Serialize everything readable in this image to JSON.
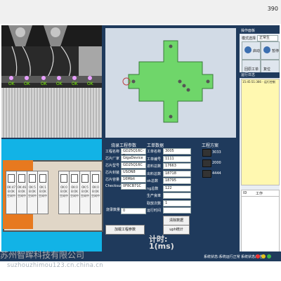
{
  "window": {
    "title_fragment": "390"
  },
  "camera": {
    "ok_marks": [
      "OK",
      "OK",
      "OK",
      "OK",
      "OK",
      "OK"
    ]
  },
  "tray": {
    "slots": [
      {
        "status": "OK:47",
        "lines": [
          "B:OK",
          "空闲中"
        ]
      },
      {
        "status": "OK:46",
        "lines": [
          "B:OK",
          "空闲中"
        ]
      },
      {
        "status": "OK:5",
        "lines": [
          "B:OK",
          "空闲中"
        ]
      },
      {
        "status": "OK:1",
        "lines": [
          "B:OK",
          "空闲中"
        ]
      },
      {
        "status": "OK:0",
        "lines": [
          "B:OK",
          "空闲中"
        ]
      },
      {
        "status": "OK:0",
        "lines": [
          "B:OK",
          "空闲中"
        ]
      },
      {
        "status": "OK:5",
        "lines": [
          "B:OK",
          "空闲中"
        ]
      },
      {
        "status": "OK:0",
        "lines": [
          "B:OK",
          "空闲中"
        ]
      }
    ]
  },
  "process_params": {
    "title": "烧录工程参数",
    "fields": [
      {
        "label": "工程名称",
        "value": "GD25Q16C-E"
      },
      {
        "label": "芯片厂家",
        "value": "GigaDevice"
      },
      {
        "label": "芯片型号",
        "value": "GD25Q16C"
      },
      {
        "label": "芯片封装",
        "value": "USON8"
      },
      {
        "label": "芯片容量",
        "value": "16Mbit"
      },
      {
        "label": "Checksum",
        "value": "0F8CB71C"
      }
    ],
    "extra_label": "烧录数量",
    "extra_value": "0",
    "load_button": "加载工程参数"
  },
  "work_data": {
    "title": "工单数据",
    "fields": [
      {
        "label": "工单名称",
        "value": "3005"
      },
      {
        "label": "工单编号",
        "value": "1111"
      },
      {
        "label": "进料总数",
        "value": "17663"
      },
      {
        "label": "出料总数",
        "value": "18718"
      },
      {
        "label": "ok总数",
        "value": "18795"
      },
      {
        "label": "ng总数",
        "value": "122"
      },
      {
        "label": "生产良率",
        "value": ""
      },
      {
        "label": "取放次数",
        "value": "1"
      },
      {
        "label": "运行时间",
        "value": ""
      }
    ],
    "clear_button": "清除数据",
    "uph_button": "uph统计",
    "timer_label": "计时:",
    "timer_value": "1(ms)"
  },
  "project": {
    "title": "工程方案",
    "items": [
      {
        "name": "3033"
      },
      {
        "name": "2000"
      },
      {
        "name": "4444"
      }
    ]
  },
  "operation": {
    "title": "操作面板",
    "mode_label": "模式选择",
    "mode_value": "正常生",
    "start_button": "启动",
    "stop_button": "暂停",
    "home_button": "回原工单",
    "reset_button": "复位"
  },
  "log": {
    "title": "运行日志",
    "entries": [
      {
        "text": "15:45:51:366 - 运行控制"
      }
    ]
  },
  "table": {
    "headers": [
      "ID",
      "工作"
    ]
  },
  "statusbar": {
    "left": "系统状态:系统运行正常",
    "right": "系统状态/警告"
  },
  "watermark": {
    "line1": "苏州智晖科技有限公司",
    "line2": "suzhouzhimou123.cn.china.cn"
  },
  "colors": {
    "frame": "#1f3a5c",
    "tray_bg": "#12b3e6",
    "accent_orange": "#e7791f",
    "chip_green": "#6fd66a"
  }
}
